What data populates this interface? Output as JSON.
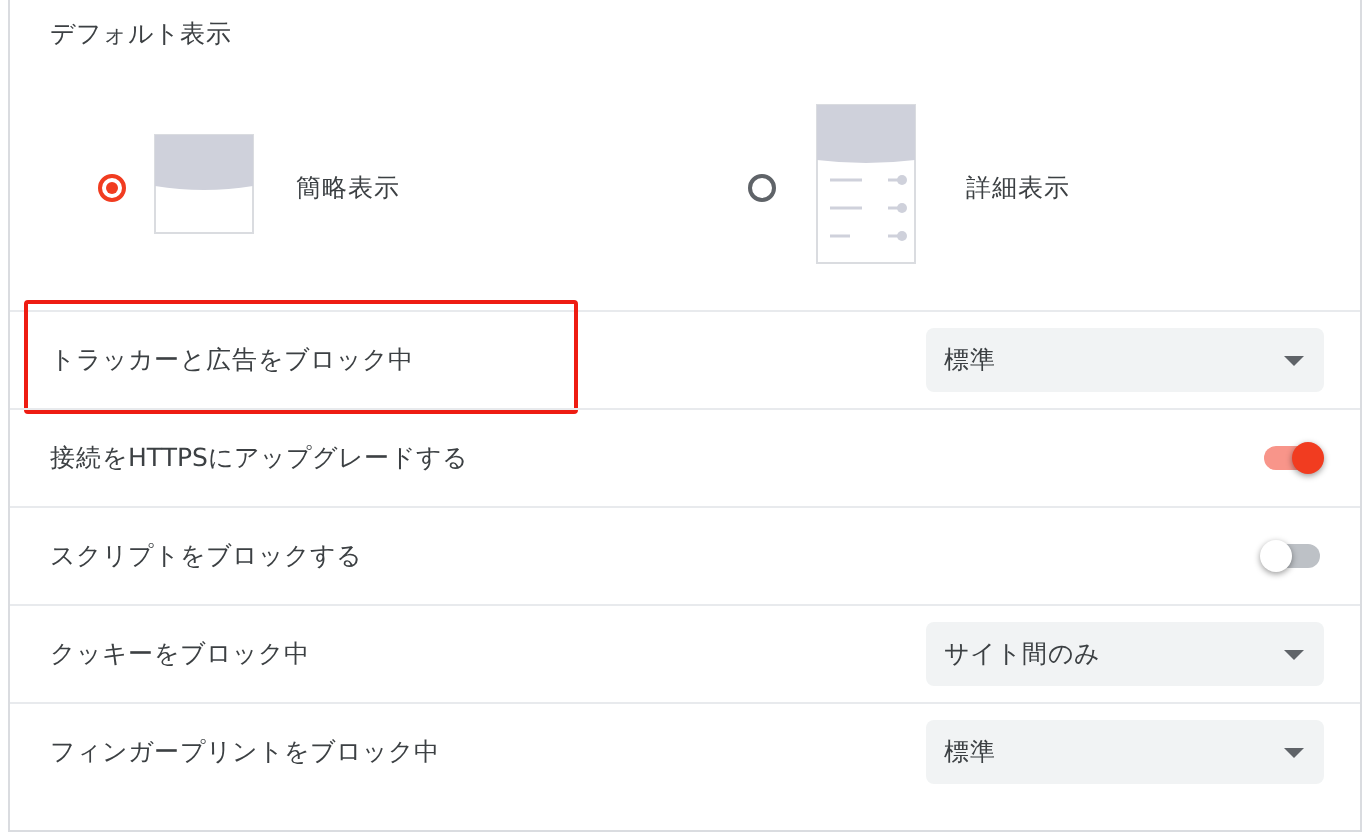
{
  "section_title": "デフォルト表示",
  "view_options": [
    {
      "label": "簡略表示",
      "selected": true,
      "kind": "compact"
    },
    {
      "label": "詳細表示",
      "selected": false,
      "kind": "detailed"
    }
  ],
  "settings": [
    {
      "kind": "select",
      "label": "トラッカーと広告をブロック中",
      "value": "標準",
      "highlighted": true
    },
    {
      "kind": "toggle",
      "label": "接続をHTTPSにアップグレードする",
      "on": true,
      "highlighted": false
    },
    {
      "kind": "toggle",
      "label": "スクリプトをブロックする",
      "on": false,
      "highlighted": false
    },
    {
      "kind": "select",
      "label": "クッキーをブロック中",
      "value": "サイト間のみ",
      "highlighted": false
    },
    {
      "kind": "select",
      "label": "フィンガープリントをブロック中",
      "value": "標準",
      "highlighted": false
    }
  ]
}
